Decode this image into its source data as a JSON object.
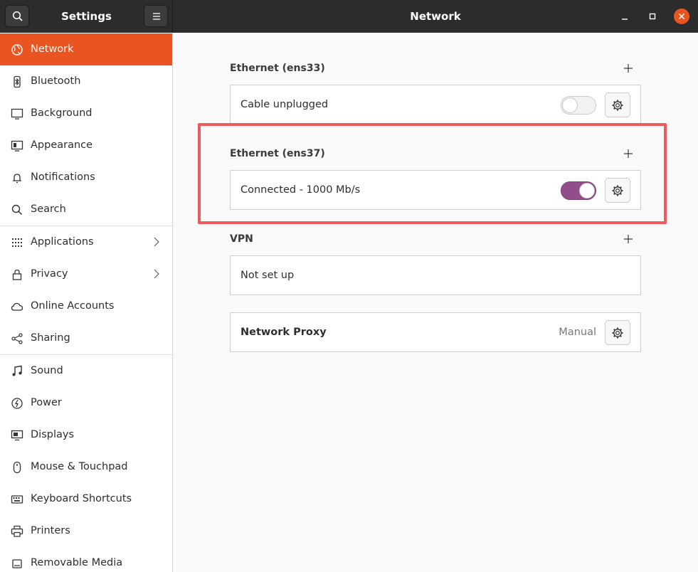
{
  "window": {
    "sidebar_title": "Settings",
    "title": "Network"
  },
  "header_icons": [
    "search-icon",
    "hamburger-menu-icon",
    "minimize-icon",
    "maximize-icon",
    "close-icon"
  ],
  "sidebar": {
    "items": [
      {
        "label": "Network",
        "icon": "network-icon",
        "active": true
      },
      {
        "label": "Bluetooth",
        "icon": "bluetooth-icon"
      },
      {
        "label": "Background",
        "icon": "background-icon"
      },
      {
        "label": "Appearance",
        "icon": "appearance-icon"
      },
      {
        "label": "Notifications",
        "icon": "bell-icon"
      },
      {
        "label": "Search",
        "icon": "search-icon"
      },
      {
        "label": "Applications",
        "icon": "grid-icon",
        "chevron": true
      },
      {
        "label": "Privacy",
        "icon": "lock-icon",
        "chevron": true
      },
      {
        "label": "Online Accounts",
        "icon": "cloud-icon"
      },
      {
        "label": "Sharing",
        "icon": "share-icon"
      },
      {
        "label": "Sound",
        "icon": "music-note-icon"
      },
      {
        "label": "Power",
        "icon": "power-icon"
      },
      {
        "label": "Displays",
        "icon": "display-icon"
      },
      {
        "label": "Mouse & Touchpad",
        "icon": "mouse-icon"
      },
      {
        "label": "Keyboard Shortcuts",
        "icon": "keyboard-icon"
      },
      {
        "label": "Printers",
        "icon": "printer-icon"
      },
      {
        "label": "Removable Media",
        "icon": "removable-media-icon"
      }
    ]
  },
  "main": {
    "ethernet1": {
      "title": "Ethernet (ens33)",
      "status": "Cable unplugged",
      "enabled": false
    },
    "ethernet2": {
      "title": "Ethernet (ens37)",
      "status": "Connected - 1000 Mb/s",
      "enabled": true
    },
    "vpn": {
      "title": "VPN",
      "status": "Not set up"
    },
    "proxy": {
      "label": "Network Proxy",
      "status": "Manual"
    }
  },
  "colors": {
    "accent": "#e95420",
    "switch_on": "#924d8b",
    "highlight": "#ee5a5f",
    "headerbar": "#2c2c2c"
  }
}
